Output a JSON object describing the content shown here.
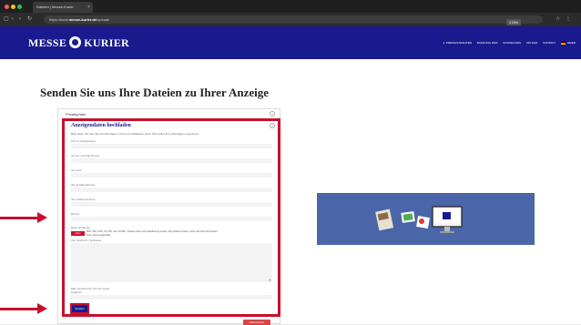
{
  "browser": {
    "tab_title": "Dateien | Messe-Kurier",
    "tab_close": "×",
    "url_prefix": "https://www.",
    "url_domain": "messe-kurier.de",
    "url_path": "/upload/",
    "zoom": "175%"
  },
  "header": {
    "logo_left": "MESSE",
    "logo_right": "KURIER",
    "nav": [
      "1. PREISLISTE/DATEN",
      "BUCHUNG 2024",
      "DOWNLOADS",
      "UPLOAD",
      "KONTAKT",
      "DE/EN"
    ],
    "brand_color": "#1a1a8f"
  },
  "page": {
    "title": "Senden Sie uns Ihre Dateien zu Ihrer Anzeige"
  },
  "form": {
    "outer_label": "Privatsphäre",
    "help_symbol": "?",
    "title": "Anzeigendaten hochladen",
    "intro": "Bitte laden Sie hier Ihre Druckvorlage und Ihre Kontaktdaten hoch. Wir prüfen Ihre Unterlagen umgehend.",
    "fields": [
      {
        "label": "Firma / Organisation"
      },
      {
        "label": "Ihr Vor- und Nachname"
      },
      {
        "label": "Ihr Land"
      },
      {
        "label": "Ihre E-Mail-Adresse"
      },
      {
        "label": "Ihre Telefonnummer"
      },
      {
        "label": "Betreff"
      }
    ],
    "file_label": "Datei anhängen",
    "file_button": "Datei auswählen",
    "file_hint_1": "PDF, JPG, PNG, TIF, ZIP, max. 50 MB – Dateien bitte in Druckauflösung senden. Bei größeren Daten nutzen Sie bitte WeTransfer.",
    "file_hint_2": "Keine Datei ausgewählt",
    "message_label": "Ihre Nachricht / Hinweise",
    "resize_glyph": "◢",
    "extra_label": "Bitte beantworten Sie die Frage:",
    "extra_sub": "Ergebnis",
    "submit_label": "Senden",
    "accent": "#c8102e"
  },
  "footer_button": "Datenschutz",
  "promo": {
    "bg": "#4a66a8"
  }
}
